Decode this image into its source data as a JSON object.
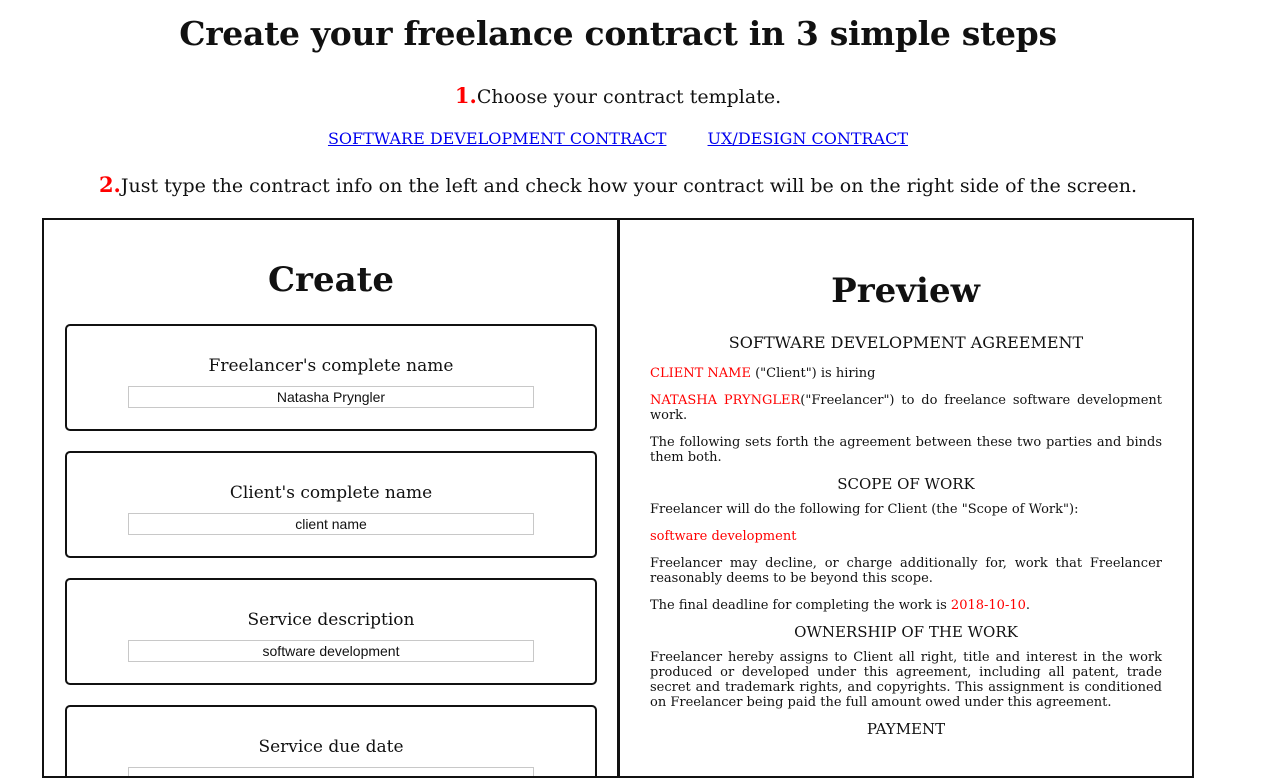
{
  "page_title": "Create your freelance contract in 3 simple steps",
  "step1": {
    "number": "1.",
    "text": "Choose your contract template."
  },
  "templates": [
    {
      "label": "SOFTWARE DEVELOPMENT CONTRACT"
    },
    {
      "label": "UX/DESIGN CONTRACT"
    }
  ],
  "step2": {
    "number": "2.",
    "text": "Just type the contract info on the left and check how your contract will be on the right side of the screen."
  },
  "create": {
    "heading": "Create",
    "fields": [
      {
        "label": "Freelancer's complete name",
        "value": "Natasha Pryngler"
      },
      {
        "label": "Client's complete name",
        "value": "client name"
      },
      {
        "label": "Service description",
        "value": "software development"
      },
      {
        "label": "Service due date",
        "value": ""
      }
    ]
  },
  "preview": {
    "heading": "Preview",
    "doc_title": "SOFTWARE DEVELOPMENT AGREEMENT",
    "client_name": "CLIENT NAME",
    "client_suffix": " (\"Client\") is hiring",
    "freelancer_name": "NATASHA PRYNGLER",
    "freelancer_suffix": "(\"Freelancer\") to do freelance software development work.",
    "intro": "The following sets forth the agreement between these two parties and binds them both.",
    "scope_heading": "SCOPE OF WORK",
    "scope_intro": "Freelancer will do the following for Client (the \"Scope of Work\"):",
    "scope_value": "software development",
    "scope_note": "Freelancer may decline, or charge additionally for, work that Freelancer reasonably deems to be beyond this scope.",
    "deadline_prefix": "The final deadline for completing the work is ",
    "deadline_value": "2018-10-10",
    "deadline_suffix": ".",
    "ownership_heading": "OWNERSHIP OF THE WORK",
    "ownership_text": "Freelancer hereby assigns to Client all right, title and interest in the work produced or developed under this agreement, including all patent, trade secret and trademark rights, and copyrights. This assignment is conditioned on Freelancer being paid the full amount owed under this agreement.",
    "payment_heading": "PAYMENT"
  },
  "colors": {
    "accent": "#ff0000",
    "link": "#0000ee",
    "border": "#111111"
  }
}
